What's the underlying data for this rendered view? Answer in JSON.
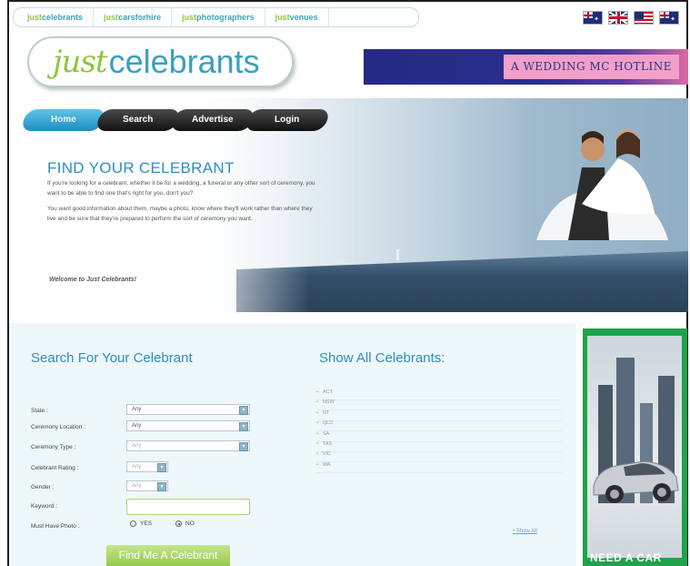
{
  "network": {
    "links": [
      {
        "prefix": "just",
        "rest": "celebrants"
      },
      {
        "prefix": "just",
        "rest": "carsforhire"
      },
      {
        "prefix": "just",
        "rest": "photographers"
      },
      {
        "prefix": "just",
        "rest": "venues"
      }
    ],
    "flags": [
      "australia-flag-icon",
      "uk-flag-icon",
      "usa-flag-icon",
      "new-zealand-flag-icon"
    ]
  },
  "logo": {
    "just": "just",
    "celebrants": "celebrants"
  },
  "banner": {
    "text": "A WEDDING MC HOTLINE"
  },
  "nav": {
    "home": "Home",
    "search": "Search",
    "advertise": "Advertise",
    "login": "Login"
  },
  "hero": {
    "title": "FIND YOUR CELEBRANT",
    "p1": "If you're looking for a celebrant, whether it be for a wedding, a funeral or any other sort of ceremony, you want to be able to find one that's right for you, don't you?",
    "p2": "You want good information about them, maybe a photo, know where they'll work rather than where they live and be sure that they're prepared to perform the sort of ceremony you want.",
    "welcome": "Welcome to Just Celebrants!"
  },
  "search": {
    "title": "Search For Your Celebrant",
    "labels": {
      "state": "State :",
      "location": "Ceremony Location :",
      "type": "Ceremony Type :",
      "rating": "Celebrant Rating :",
      "gender": "Gender :",
      "keyword": "Keyword :",
      "photo": "Must Have Photo :"
    },
    "values": {
      "state": "Any",
      "location": "Any",
      "type": "Any",
      "rating": "Any",
      "gender": "Any",
      "keyword": ""
    },
    "radio": {
      "yes": "YES",
      "no": "NO",
      "selected": "NO"
    },
    "button": "Find Me A Celebrant"
  },
  "show_all": {
    "title": "Show All Celebrants:",
    "states": [
      "ACT",
      "NSW",
      "NT",
      "QLD",
      "SA",
      "TAS",
      "VIC",
      "WA"
    ],
    "link": "Show All"
  },
  "ad": {
    "text": "NEED A CAR"
  },
  "colors": {
    "accent_blue": "#2d8fc2",
    "brand_green": "#8dc63f",
    "ad_green": "#1fa34a"
  }
}
